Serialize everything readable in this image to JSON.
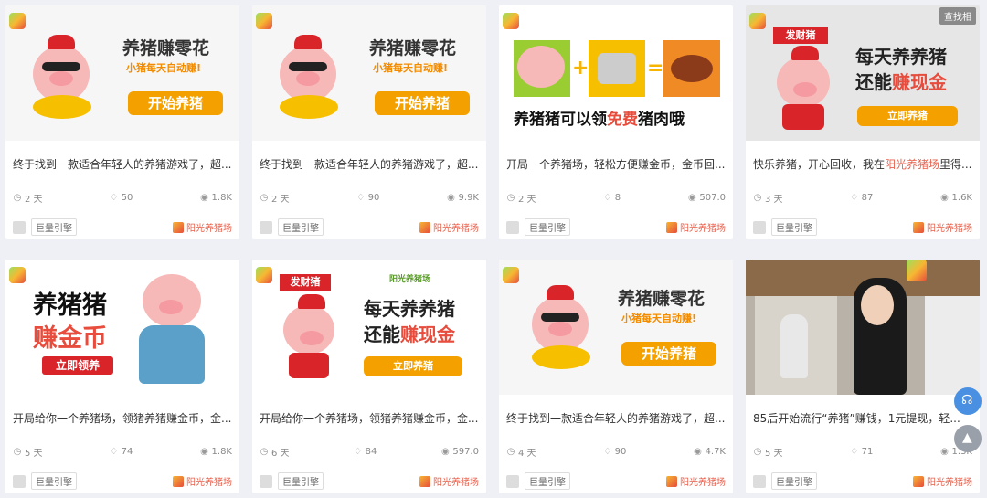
{
  "cards": [
    {
      "ad": {
        "title": "养猪赚零花",
        "subtitle": "小猪每天自动赚!",
        "button": "开始养猪"
      },
      "title": "终于找到一款适合年轻人的养猪游戏了，超...",
      "days": "2 天",
      "likes": "50",
      "views": "1.8K",
      "tag": "巨量引擎",
      "brand": "阳光养猪场"
    },
    {
      "ad": {
        "title": "养猪赚零花",
        "subtitle": "小猪每天自动赚!",
        "button": "开始养猪"
      },
      "title": "终于找到一款适合年轻人的养猪游戏了，超...",
      "days": "2 天",
      "likes": "90",
      "views": "9.9K",
      "tag": "巨量引擎",
      "brand": "阳光养猪场"
    },
    {
      "ad": {
        "caption_pre": "养猪猪可以领",
        "caption_hl": "免费",
        "caption_post": "猪肉哦"
      },
      "title": "开局一个养猪场，轻松方便赚金币，金币回...",
      "days": "2 天",
      "likes": "8",
      "views": "507.0",
      "tag": "巨量引擎",
      "brand": "阳光养猪场"
    },
    {
      "ad": {
        "badge": "发财猪",
        "line1": "每天养养猪",
        "line2_pre": "还能",
        "line2_hl": "赚现金",
        "button": "立即养猪",
        "corner": "查找相"
      },
      "title_pre": "快乐养猪，开心回收，我在",
      "title_hl": "阳光养猪场",
      "title_post": "里得...",
      "days": "3 天",
      "likes": "87",
      "views": "1.6K",
      "tag": "巨量引擎",
      "brand": "阳光养猪场"
    },
    {
      "ad": {
        "line1": "养猪猪",
        "line2": "赚金币",
        "button": "立即领养"
      },
      "title": "开局给你一个养猪场，领猪养猪赚金币，金...",
      "days": "5 天",
      "likes": "74",
      "views": "1.8K",
      "tag": "巨量引擎",
      "brand": "阳光养猪场"
    },
    {
      "ad": {
        "badge": "发财猪",
        "brandline": "阳光养猪场",
        "line1": "每天养养猪",
        "line2_pre": "还能",
        "line2_hl": "赚现金",
        "button": "立即养猪"
      },
      "title": "开局给你一个养猪场，领猪养猪赚金币，金...",
      "days": "6 天",
      "likes": "84",
      "views": "597.0",
      "tag": "巨量引擎",
      "brand": "阳光养猪场"
    },
    {
      "ad": {
        "title": "养猪赚零花",
        "subtitle": "小猪每天自动赚!",
        "button": "开始养猪"
      },
      "title": "终于找到一款适合年轻人的养猪游戏了，超...",
      "days": "4 天",
      "likes": "90",
      "views": "4.7K",
      "tag": "巨量引擎",
      "brand": "阳光养猪场"
    },
    {
      "ad": {},
      "title": "85后开始流行“养猪”赚钱，1元提现，轻...",
      "days": "5 天",
      "likes": "71",
      "views": "1.3K",
      "tag": "巨量引擎",
      "brand": "阳光养猪场"
    }
  ],
  "colors": {
    "accent": "#e8604c",
    "button": "#f4a100",
    "background": "#eef0f5"
  }
}
